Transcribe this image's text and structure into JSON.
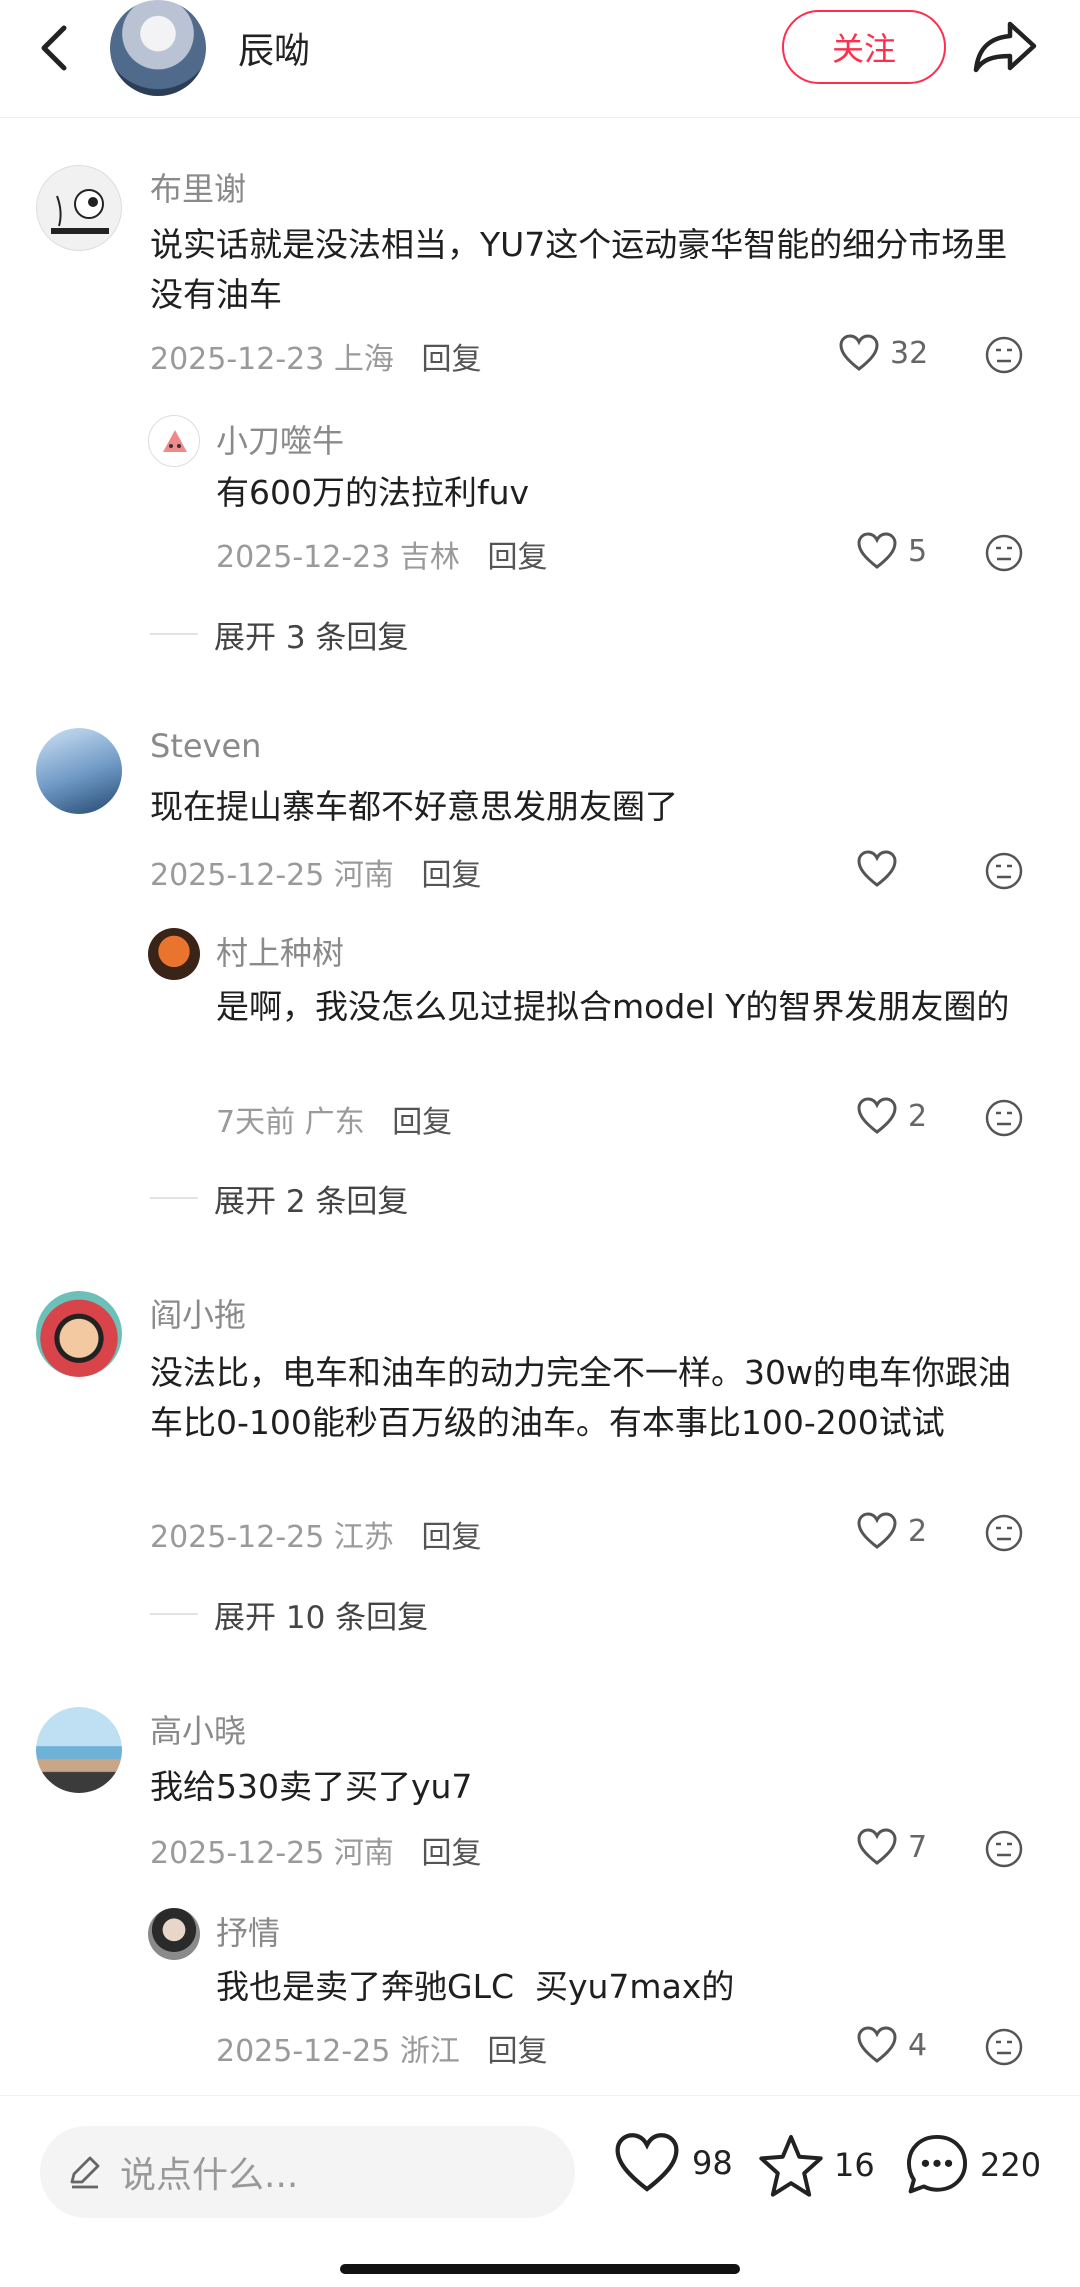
{
  "header": {
    "name": "辰呦",
    "follow_label": "关注"
  },
  "comments": [
    {
      "user": "布里谢",
      "text": "说实话就是没法相当，YU7这个运动豪华智能的细分市场里没有油车",
      "date": "2025-12-23",
      "location": "上海",
      "reply_label": "回复",
      "likes": "32",
      "reply": {
        "user": "小刀噬牛",
        "text": "有600万的法拉利fuv",
        "date": "2025-12-23",
        "location": "吉林",
        "reply_label": "回复",
        "likes": "5"
      },
      "expand": "展开 3 条回复"
    },
    {
      "user": "Steven",
      "text": "现在提山寨车都不好意思发朋友圈了",
      "date": "2025-12-25",
      "location": "河南",
      "reply_label": "回复",
      "likes": "",
      "reply": {
        "user": "村上种树",
        "text": "是啊，我没怎么见过提拟合model Y的智界发朋友圈的",
        "date": "7天前",
        "location": "广东",
        "reply_label": "回复",
        "likes": "2"
      },
      "expand": "展开 2 条回复"
    },
    {
      "user": "阎小拖",
      "text": "没法比，电车和油车的动力完全不一样。30w的电车你跟油车比0-100能秒百万级的油车。有本事比100-200试试",
      "date": "2025-12-25",
      "location": "江苏",
      "reply_label": "回复",
      "likes": "2",
      "expand": "展开 10 条回复"
    },
    {
      "user": "高小晓",
      "text": "我给530卖了买了yu7",
      "date": "2025-12-25",
      "location": "河南",
      "reply_label": "回复",
      "likes": "7",
      "reply": {
        "user": "抒情",
        "text": "我也是卖了奔驰GLC  买yu7max的",
        "date": "2025-12-25",
        "location": "浙江",
        "reply_label": "回复",
        "likes": "4"
      }
    }
  ],
  "bottom": {
    "placeholder": "说点什么...",
    "likes": "98",
    "stars": "16",
    "comments": "220"
  },
  "colors": {
    "accent": "#ff2e4d",
    "muted": "#9a9a9a"
  }
}
